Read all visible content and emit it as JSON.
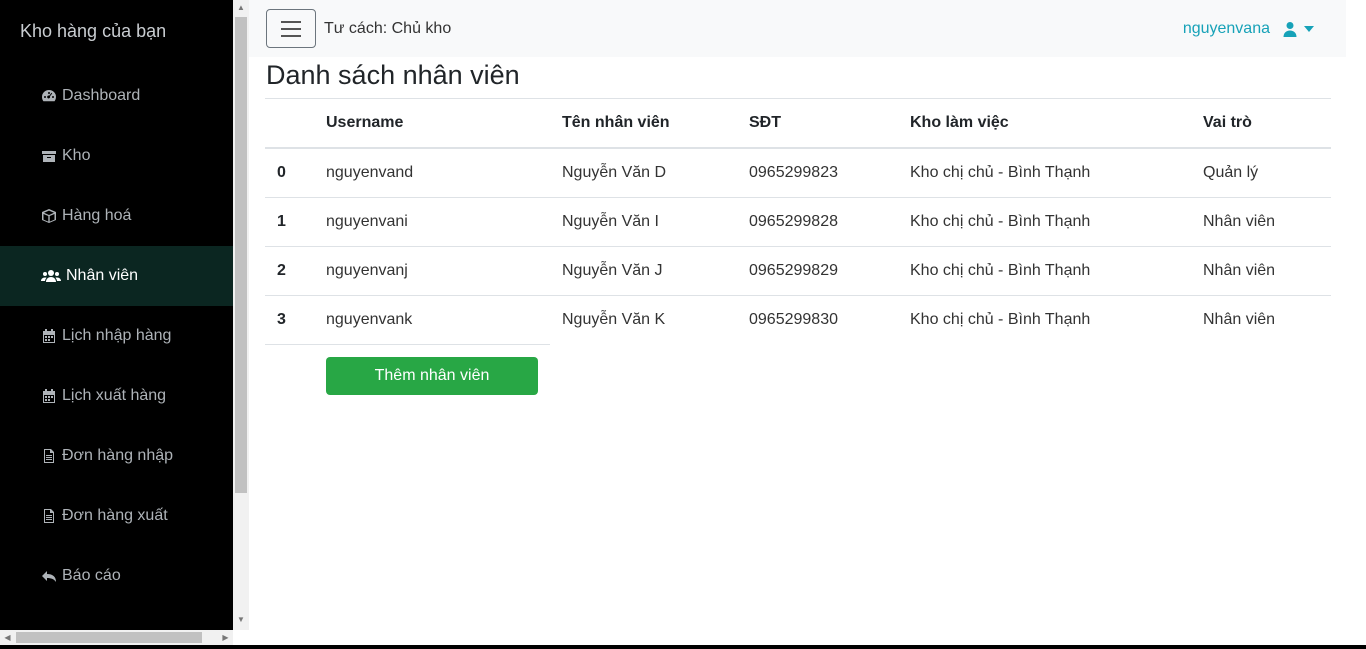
{
  "sidebar": {
    "brand": "Kho hàng của bạn",
    "items": [
      {
        "label": "Dashboard",
        "icon": "dashboard-icon"
      },
      {
        "label": "Kho",
        "icon": "box-icon"
      },
      {
        "label": "Hàng hoá",
        "icon": "cube-icon"
      },
      {
        "label": "Nhân viên",
        "icon": "users-icon",
        "active": true
      },
      {
        "label": "Lịch nhập hàng",
        "icon": "calendar-icon"
      },
      {
        "label": "Lịch xuất hàng",
        "icon": "calendar-icon"
      },
      {
        "label": "Đơn hàng nhập",
        "icon": "document-icon"
      },
      {
        "label": "Đơn hàng xuất",
        "icon": "document-icon"
      },
      {
        "label": "Báo cáo",
        "icon": "reply-icon"
      }
    ]
  },
  "topbar": {
    "role": "Tư cách: Chủ kho",
    "username": "nguyenvana",
    "user_icon": "user-icon"
  },
  "page": {
    "title": "Danh sách nhân viên"
  },
  "table": {
    "headers": [
      "",
      "Username",
      "Tên nhân viên",
      "SĐT",
      "Kho làm việc",
      "Vai trò"
    ],
    "rows": [
      [
        "0",
        "nguyenvand",
        "Nguyễn Văn D",
        "0965299823",
        "Kho chị chủ - Bình Thạnh",
        "Quản lý"
      ],
      [
        "1",
        "nguyenvani",
        "Nguyễn Văn I",
        "0965299828",
        "Kho chị chủ - Bình Thạnh",
        "Nhân viên"
      ],
      [
        "2",
        "nguyenvanj",
        "Nguyễn Văn J",
        "0965299829",
        "Kho chị chủ - Bình Thạnh",
        "Nhân viên"
      ],
      [
        "3",
        "nguyenvank",
        "Nguyễn Văn K",
        "0965299830",
        "Kho chị chủ - Bình Thạnh",
        "Nhân viên"
      ]
    ]
  },
  "add_button": "Thêm nhân viên",
  "colors": {
    "sidebar_bg": "#000000",
    "sidebar_active": "#0b2621",
    "accent": "#17a2b8",
    "add_button": "#28a745"
  }
}
